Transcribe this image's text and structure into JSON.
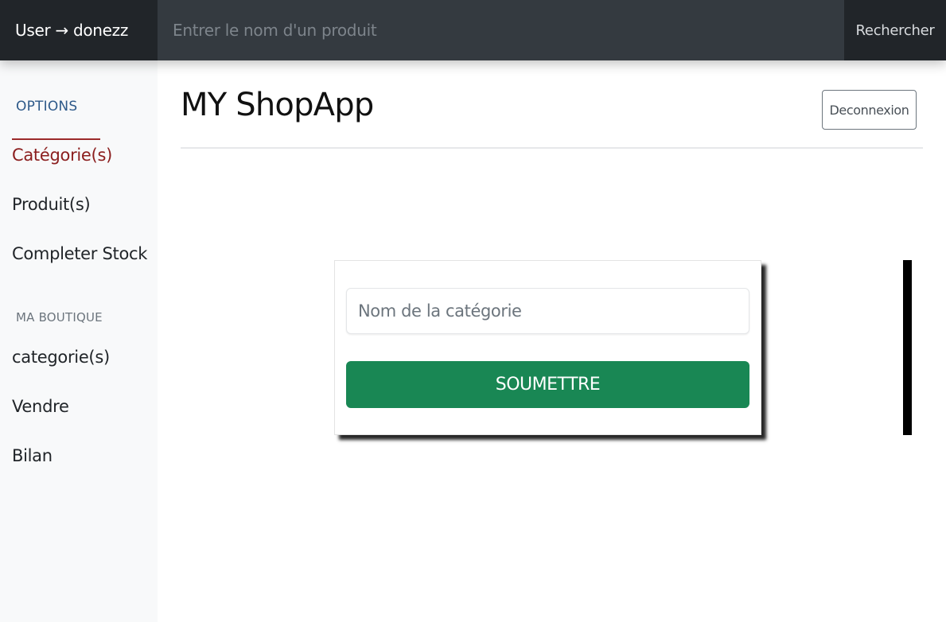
{
  "navbar": {
    "brand": "User → donezz",
    "search_placeholder": "Entrer le nom d'un produit",
    "search_button": "Rechercher"
  },
  "sidebar": {
    "options_heading": "OPTIONS",
    "options_items": [
      {
        "label": "Catégorie(s)",
        "active": true
      },
      {
        "label": "Produit(s)",
        "active": false
      },
      {
        "label": "Completer Stock",
        "active": false
      }
    ],
    "shop_heading": "MA BOUTIQUE",
    "shop_items": [
      {
        "label": "categorie(s)"
      },
      {
        "label": "Vendre"
      },
      {
        "label": "Bilan"
      }
    ]
  },
  "header": {
    "title": "MY ShopApp",
    "logout_button": "Deconnexion"
  },
  "form": {
    "category_placeholder": "Nom de la catégorie",
    "category_value": "",
    "submit_button": "SOUMETTRE"
  },
  "colors": {
    "navbar_bg": "#343a40",
    "brand_bg": "#212529",
    "active_item": "#8b1e1e",
    "submit_bg": "#198754"
  }
}
